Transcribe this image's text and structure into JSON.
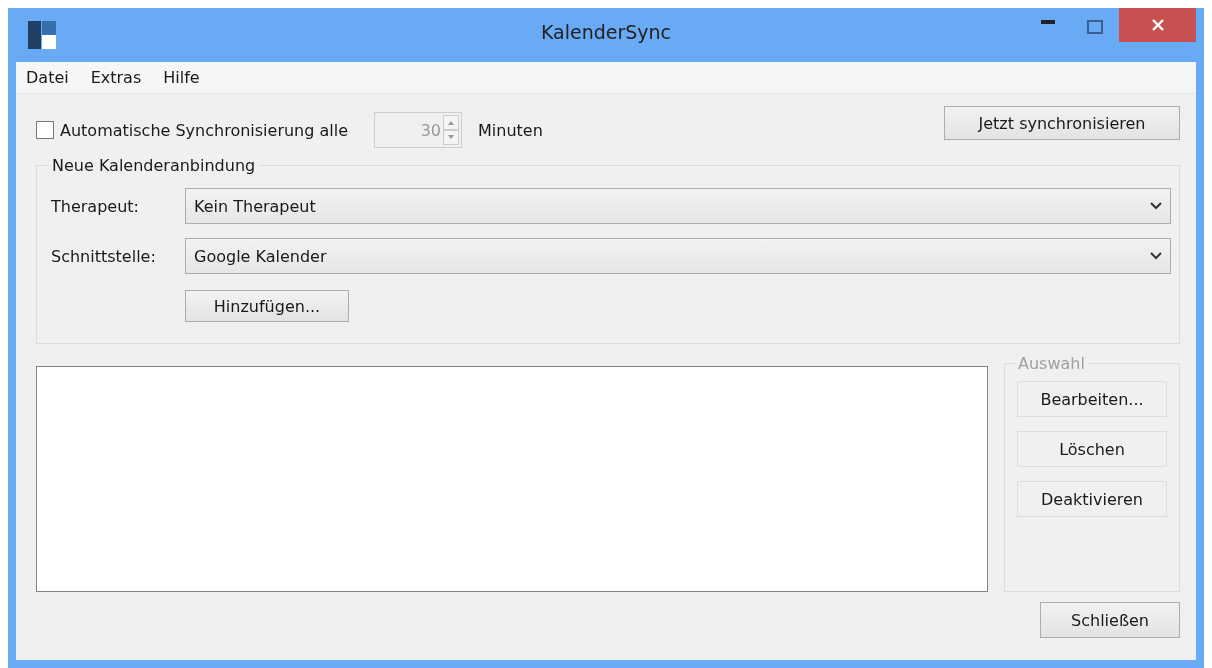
{
  "window": {
    "title": "KalenderSync"
  },
  "menu": [
    "Datei",
    "Extras",
    "Hilfe"
  ],
  "auto_sync": {
    "label": "Automatische Synchronisierung alle",
    "checked": false,
    "interval": "30",
    "interval_disabled": true,
    "unit": "Minuten"
  },
  "sync_button": "Jetzt synchronisieren",
  "new_binding": {
    "title": "Neue Kalenderanbindung",
    "fields": [
      {
        "label": "Therapeut:",
        "value": "Kein Therapeut"
      },
      {
        "label": "Schnittstelle:",
        "value": "Google Kalender"
      }
    ],
    "add_button": "Hinzufügen..."
  },
  "selection": {
    "title": "Auswahl",
    "disabled": true,
    "buttons": [
      "Bearbeiten...",
      "Löschen",
      "Deaktivieren"
    ]
  },
  "close_button": "Schließen"
}
